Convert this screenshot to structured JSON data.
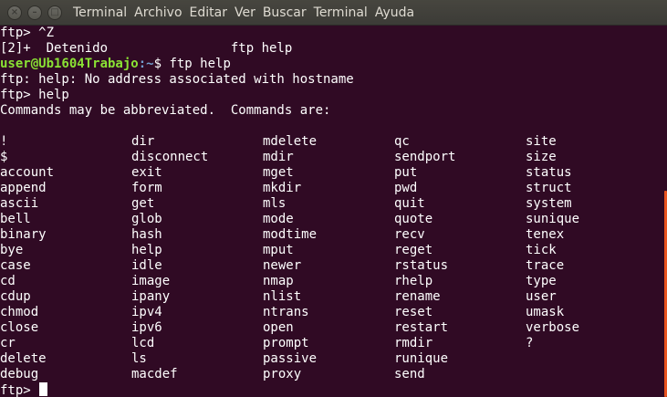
{
  "window": {
    "menu": [
      "Terminal",
      "Archivo",
      "Editar",
      "Ver",
      "Buscar",
      "Terminal",
      "Ayuda"
    ],
    "close_glyph": "×",
    "minimize_glyph": "–",
    "maximize_glyph": "□"
  },
  "terminal": {
    "line1": "ftp> ^Z",
    "line2": "[2]+  Detenido                ftp help",
    "prompt_user": "user@Ub1604Trabajo",
    "prompt_sep": ":",
    "prompt_path": "~",
    "prompt_cmd": "$ ftp help",
    "line4": "ftp: help: No address associated with hostname",
    "line5": "ftp> help",
    "line6": "Commands may be abbreviated.  Commands are:",
    "final_prompt": "ftp>",
    "columns": [
      [
        "!",
        "$",
        "account",
        "append",
        "ascii",
        "bell",
        "binary",
        "bye",
        "case",
        "cd",
        "cdup",
        "chmod",
        "close",
        "cr",
        "delete",
        "debug"
      ],
      [
        "dir",
        "disconnect",
        "exit",
        "form",
        "get",
        "glob",
        "hash",
        "help",
        "idle",
        "image",
        "ipany",
        "ipv4",
        "ipv6",
        "lcd",
        "ls",
        "macdef"
      ],
      [
        "mdelete",
        "mdir",
        "mget",
        "mkdir",
        "mls",
        "mode",
        "modtime",
        "mput",
        "newer",
        "nmap",
        "nlist",
        "ntrans",
        "open",
        "prompt",
        "passive",
        "proxy"
      ],
      [
        "qc",
        "sendport",
        "put",
        "pwd",
        "quit",
        "quote",
        "recv",
        "reget",
        "rstatus",
        "rhelp",
        "rename",
        "reset",
        "restart",
        "rmdir",
        "runique",
        "send"
      ],
      [
        "site",
        "size",
        "status",
        "struct",
        "system",
        "sunique",
        "tenex",
        "tick",
        "trace",
        "type",
        "user",
        "umask",
        "verbose",
        "?"
      ]
    ]
  },
  "colors": {
    "background": "#300a24",
    "foreground": "#ffffff",
    "prompt_user": "#8ae234",
    "prompt_path": "#729fcf",
    "scrollbar": "#e95420"
  }
}
